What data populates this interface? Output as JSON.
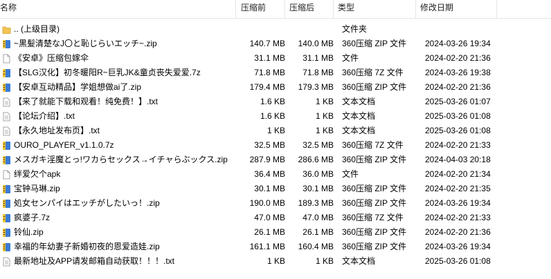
{
  "columns": {
    "name": "名称",
    "size": "压缩前",
    "packed": "压缩后",
    "type": "类型",
    "modified": "修改日期"
  },
  "parent": {
    "name": ".. (上级目录)",
    "type": "文件夹"
  },
  "files": [
    {
      "icon": "zip-archive-icon",
      "name": "~黒髪清楚なJ〇と恥じらいエッチ~.zip",
      "size": "140.7 MB",
      "packed": "140.0 MB",
      "type": "360压缩 ZIP 文件",
      "date": "2024-03-26 19:34"
    },
    {
      "icon": "generic-file-icon",
      "name": "《安卓》压缩包嫁伞",
      "size": "31.1 MB",
      "packed": "31.1 MB",
      "type": "文件",
      "date": "2024-02-20 21:36"
    },
    {
      "icon": "7z-archive-icon",
      "name": "【SLG汉化】初冬暖阳R~巨乳JK&童贞丧失爱爱.7z",
      "size": "71.8 MB",
      "packed": "71.8 MB",
      "type": "360压缩 7Z 文件",
      "date": "2024-03-26 19:38"
    },
    {
      "icon": "zip-archive-icon",
      "name": "【安卓互动精品】学姐想做ai了.zip",
      "size": "179.4 MB",
      "packed": "179.3 MB",
      "type": "360压缩 ZIP 文件",
      "date": "2024-02-20 21:36"
    },
    {
      "icon": "text-file-icon",
      "name": "【来了就能下载和观看！纯免费！】.txt",
      "size": "1.6 KB",
      "packed": "1 KB",
      "type": "文本文档",
      "date": "2025-03-26 01:07"
    },
    {
      "icon": "text-file-icon",
      "name": "【论坛介绍】.txt",
      "size": "1.6 KB",
      "packed": "1 KB",
      "type": "文本文档",
      "date": "2025-03-26 01:08"
    },
    {
      "icon": "text-file-icon",
      "name": "【永久地址发布页】.txt",
      "size": "1 KB",
      "packed": "1 KB",
      "type": "文本文档",
      "date": "2025-03-26 01:08"
    },
    {
      "icon": "7z-archive-icon",
      "name": "OURO_PLAYER_v1.1.0.7z",
      "size": "32.5 MB",
      "packed": "32.5 MB",
      "type": "360压缩 7Z 文件",
      "date": "2024-02-20 21:33"
    },
    {
      "icon": "zip-archive-icon",
      "name": "メスガキ淫魔とっ!ワカらセックス→イチャらぶックス.zip",
      "size": "287.9 MB",
      "packed": "286.6 MB",
      "type": "360压缩 ZIP 文件",
      "date": "2024-04-03 20:18"
    },
    {
      "icon": "generic-file-icon",
      "name": "绊爱欠个apk",
      "size": "36.4 MB",
      "packed": "36.0 MB",
      "type": "文件",
      "date": "2024-02-20 21:34"
    },
    {
      "icon": "zip-archive-icon",
      "name": "宝钟马琳.zip",
      "size": "30.1 MB",
      "packed": "30.1 MB",
      "type": "360压缩 ZIP 文件",
      "date": "2024-02-20 21:35"
    },
    {
      "icon": "zip-archive-icon",
      "name": "処女センパイはエッチがしたいっ！.zip",
      "size": "190.0 MB",
      "packed": "189.3 MB",
      "type": "360压缩 ZIP 文件",
      "date": "2024-03-26 19:34"
    },
    {
      "icon": "7z-archive-icon",
      "name": "疯婆子.7z",
      "size": "47.0 MB",
      "packed": "47.0 MB",
      "type": "360压缩 7Z 文件",
      "date": "2024-02-20 21:33"
    },
    {
      "icon": "zip-archive-icon",
      "name": "铃仙.zip",
      "size": "26.1 MB",
      "packed": "26.1 MB",
      "type": "360压缩 ZIP 文件",
      "date": "2024-02-20 21:36"
    },
    {
      "icon": "zip-archive-icon",
      "name": "幸福的年幼妻子新婚初夜的恩爱造娃.zip",
      "size": "161.1 MB",
      "packed": "160.4 MB",
      "type": "360压缩 ZIP 文件",
      "date": "2024-03-26 19:34"
    },
    {
      "icon": "text-file-icon",
      "name": "最新地址及APP请发邮箱自动获取！！！.txt",
      "size": "1 KB",
      "packed": "1 KB",
      "type": "文本文档",
      "date": "2025-03-26 01:08"
    }
  ]
}
